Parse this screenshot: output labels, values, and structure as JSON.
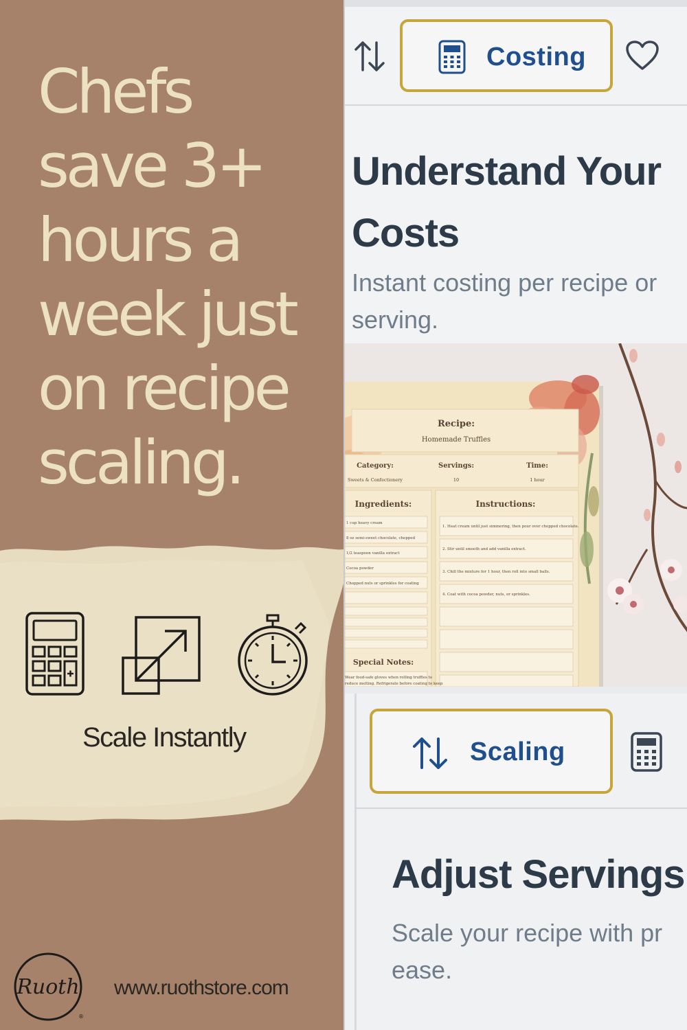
{
  "promo": {
    "headline_lines": [
      "Chefs",
      "save 3+",
      "hours a",
      "week just",
      "on recipe",
      "scaling."
    ],
    "feature_label": "Scale Instantly",
    "icons": [
      "calculator-icon",
      "resize-arrow-icon",
      "stopwatch-icon"
    ],
    "logo_text": "Ruoth",
    "website": "www.ruothstore.com"
  },
  "costing_card": {
    "sort_icon": "sort-arrows-icon",
    "tab_icon": "calculator-icon",
    "tab_label": "Costing",
    "favorite_icon": "heart-icon",
    "title_lines": [
      "Understand Your",
      "Costs"
    ],
    "subtitle_lines": [
      "Instant costing per recipe or",
      "serving."
    ]
  },
  "recipe_card": {
    "recipe_heading": "Recipe:",
    "recipe_name": "Homemade Truffles",
    "category_label": "Category:",
    "category_value": "Sweets & Confectionery",
    "servings_label": "Servings:",
    "servings_value": "10",
    "time_label": "Time:",
    "time_value": "1 hour",
    "ingredients_label": "Ingredients:",
    "ingredients": [
      "1 cup heavy cream",
      "8 oz semi-sweet chocolate, chopped",
      "1/2 teaspoon vanilla extract",
      "Cocoa powder",
      "Chopped nuts or sprinkles for coating"
    ],
    "instructions_label": "Instructions:",
    "instructions": [
      "1. Heat cream until just simmering, then pour over chopped chocolate.",
      "2. Stir until smooth and add vanilla extract.",
      "3. Chill the mixture for 1 hour, then roll into small balls.",
      "4. Coat with cocoa powder, nuts, or sprinkles."
    ],
    "notes_label": "Special Notes:",
    "notes_lines": [
      "Wear food-safe gloves when rolling truffles to",
      "reduce melting. Refrigerate before coating to keep"
    ]
  },
  "scaling_card": {
    "tab_icon": "sort-arrows-icon",
    "tab_label": "Scaling",
    "next_tab_icon": "calculator-icon",
    "title": "Adjust Servings",
    "subtitle_lines": [
      "Scale your recipe with pr",
      "ease."
    ]
  },
  "colors": {
    "left_bg": "#a6826b",
    "headline": "#ece2c2",
    "tab_border": "#c6a63a",
    "tab_text": "#1f4f8c",
    "title_text": "#2d3a48",
    "subtitle_text": "#6f7c8a"
  }
}
